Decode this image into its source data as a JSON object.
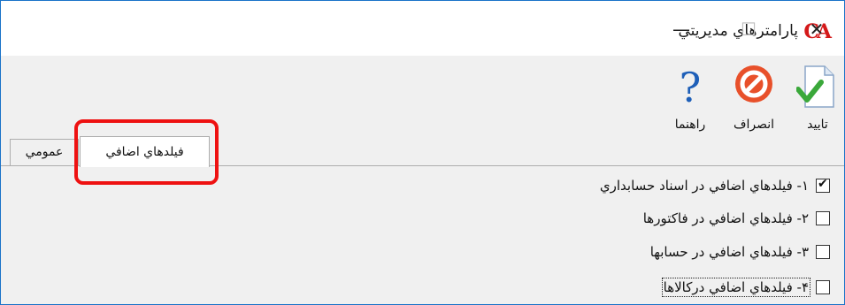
{
  "window": {
    "title": "پارامترهاي مديريتي",
    "logo_text": "CA",
    "controls": {
      "minimize": "—",
      "maximize": "☐",
      "close": "✕"
    }
  },
  "toolbar": {
    "ok_label": "تاييد",
    "cancel_label": "انصراف",
    "help_label": "راهنما",
    "help_glyph": "?"
  },
  "tabs": [
    {
      "label": "عمومي"
    },
    {
      "label": "فيلدهاي اضافي"
    }
  ],
  "options": [
    {
      "label": "١- فيلدهاي اضافي در اسناد حسابداري",
      "checked": true,
      "check_glyph": "✔"
    },
    {
      "label": "٢- فيلدهاي اضافي در فاكتورها",
      "checked": false
    },
    {
      "label": "٣- فيلدهاي اضافي در حسابها",
      "checked": false
    },
    {
      "label": "۴- فيلدهاي اضافي دركالاها",
      "checked": false
    }
  ],
  "colors": {
    "accent_border": "#1a73c8",
    "highlight": "#ee1111",
    "logo": "#d4191a",
    "cancel_icon": "#e8502a",
    "help_icon": "#1e5fb8",
    "ok_check": "#3aa83a"
  }
}
